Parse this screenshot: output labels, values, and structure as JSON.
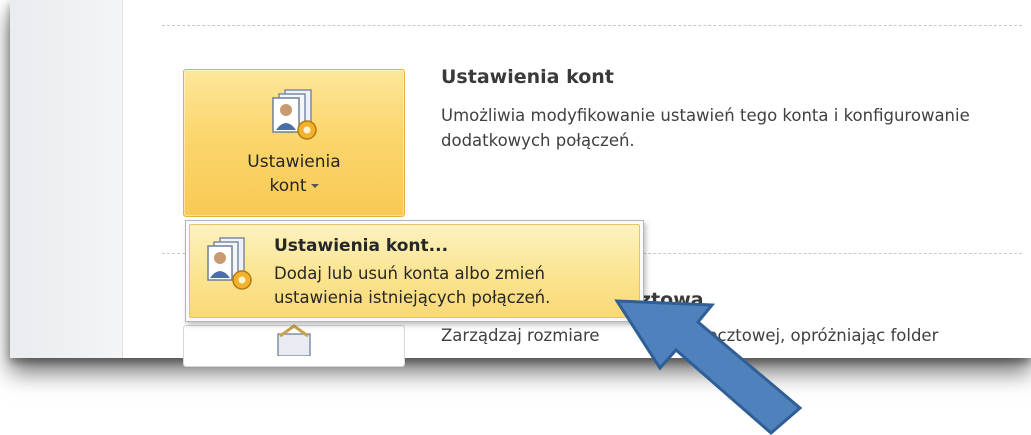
{
  "account_settings": {
    "button_label_line1": "Ustawienia",
    "button_label_line2": "kont",
    "title": "Ustawienia kont",
    "description": "Umożliwia modyfikowanie ustawień tego konta i konfigurowanie dodatkowych połączeń."
  },
  "dropdown": {
    "item_title": "Ustawienia kont...",
    "item_description": "Dodaj lub usuń konta albo zmień ustawienia istniejących połączeń."
  },
  "mailbox_section": {
    "title_visible": "ztową",
    "description_visible_start": "Zarządzaj rozmiare",
    "description_visible_end": "ki pocztowej, opróżniając folder"
  },
  "colors": {
    "button_orange": "#f8c955",
    "menu_highlight": "#fbe490",
    "arrow_blue": "#4a7ec0"
  },
  "icons": [
    "account-settings-icon",
    "gear-icon",
    "mailbox-cleanup-icon",
    "dropdown-caret-icon"
  ]
}
